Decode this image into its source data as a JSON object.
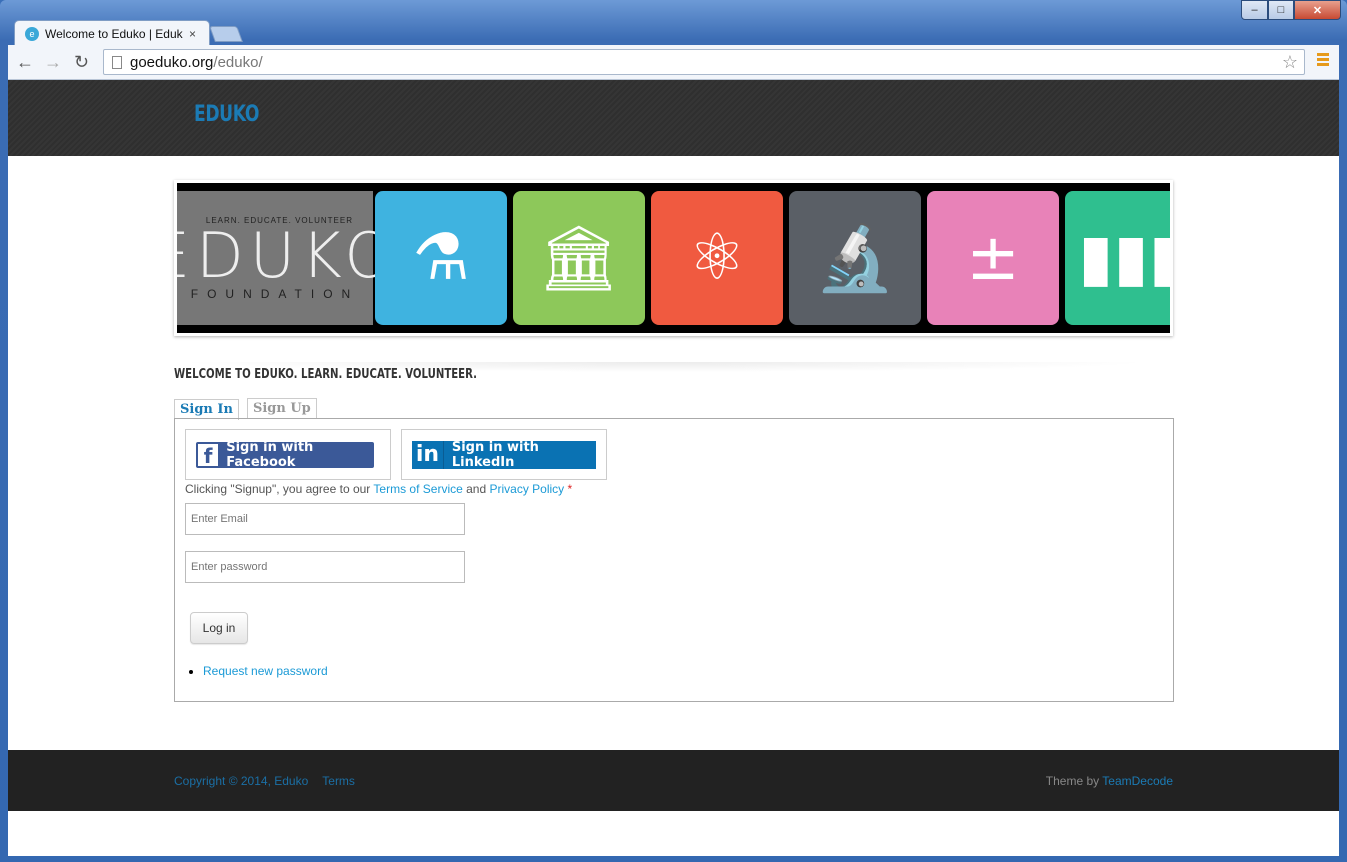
{
  "browser": {
    "tab_title": "Welcome to Eduko | Eduko",
    "tab_close": "×",
    "url_host": "goeduko.org",
    "url_path": "/eduko/",
    "win_min": "–",
    "win_max": "□",
    "win_close": "✕"
  },
  "header": {
    "site_name": "EDUKO"
  },
  "banner": {
    "logo_tagline": "LEARN. EDUCATE. VOLUNTEER",
    "logo_text": "EDUKO",
    "logo_subtext": "FOUNDATION",
    "tiles": [
      {
        "icon": "flask-icon",
        "color": "#3fb3e0"
      },
      {
        "icon": "museum-icon",
        "color": "#8dc85a"
      },
      {
        "icon": "atom-icon",
        "color": "#f05a40"
      },
      {
        "icon": "microscope-icon",
        "color": "#5a5f66"
      },
      {
        "icon": "calculator-icon",
        "color": "#e882b8"
      },
      {
        "icon": "books-icon",
        "color": "#2fbf8f"
      }
    ]
  },
  "welcome": {
    "heading": "WELCOME TO EDUKO. LEARN. EDUCATE. VOLUNTEER."
  },
  "auth_tabs": {
    "signin": "Sign In",
    "signup": "Sign Up"
  },
  "form": {
    "facebook_label": "Sign in with Facebook",
    "linkedin_label": "Sign in with LinkedIn",
    "terms_prefix": "Clicking \"Signup\", you agree to our ",
    "terms_link": "Terms of Service",
    "terms_and": " and ",
    "privacy_link": "Privacy Policy",
    "required_mark": "*",
    "email_placeholder": "Enter Email",
    "password_placeholder": "Enter password",
    "login_label": "Log in",
    "request_password": "Request new password"
  },
  "footer": {
    "copyright": "Copyright © 2014, Eduko",
    "terms": "Terms",
    "theme_prefix": "Theme by ",
    "theme_credit": "TeamDecode"
  },
  "colors": {
    "accent": "#1b7bb5",
    "link": "#1b9ad6",
    "facebook": "#3b5998",
    "linkedin": "#0a72b3",
    "header_bg": "#2f2f2f",
    "footer_bg": "#222222"
  }
}
